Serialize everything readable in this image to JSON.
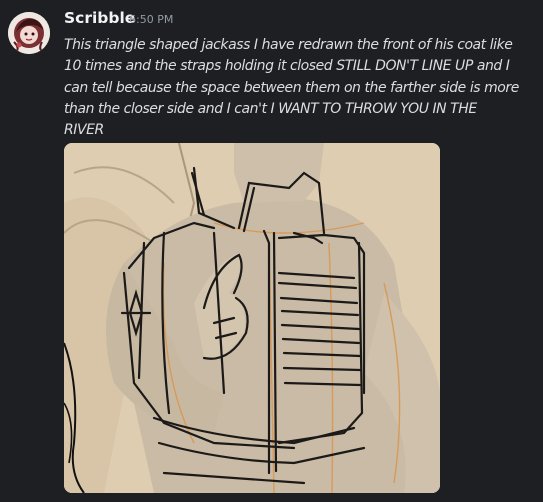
{
  "message": {
    "author": "Scribble",
    "timestamp": "6:50 PM",
    "content_lines": [
      "This triangle shaped jackass I have redrawn the front of his coat like",
      "10 times and the straps holding it closed STILL DON'T LINE UP and I",
      "can tell because the space between them on the farther side is more",
      "than the closer side and I can't I WANT TO THROW YOU IN THE",
      "RIVER"
    ]
  },
  "colors": {
    "background": "#1e1f22",
    "username": "#f2f3f5",
    "text": "#dbdee1",
    "timestamp": "#949ba4",
    "sketch_paper": "#dfcdb1"
  },
  "icons": {
    "avatar": "user-avatar-drawing"
  }
}
